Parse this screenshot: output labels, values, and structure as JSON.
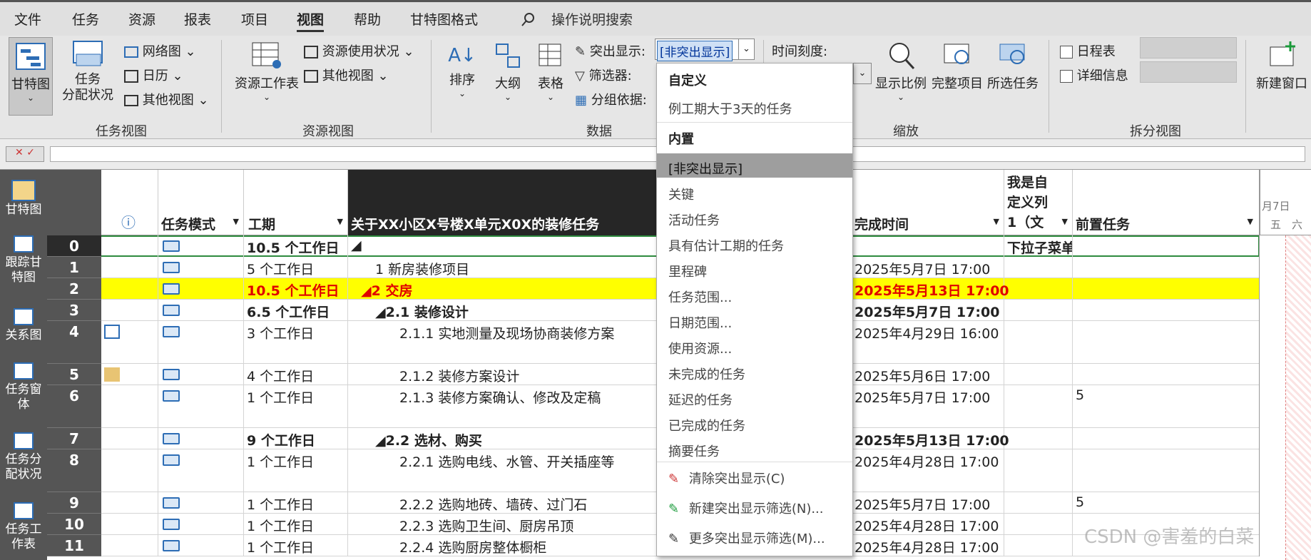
{
  "menubar": {
    "items": [
      "文件",
      "任务",
      "资源",
      "报表",
      "项目",
      "视图",
      "帮助",
      "甘特图格式"
    ],
    "active": "视图",
    "search": "操作说明搜索"
  },
  "ribbon": {
    "task_view": {
      "gantt": "甘特图",
      "assign": "任务\n分配状况",
      "network": "网络图",
      "calendar": "日历",
      "other": "其他视图",
      "label": "任务视图"
    },
    "resource_view": {
      "sheet": "资源工作表",
      "usage": "资源使用状况",
      "other": "其他视图",
      "label": "资源视图"
    },
    "data": {
      "sort": "排序",
      "outline": "大纲",
      "table": "表格",
      "highlight_label": "突出显示:",
      "highlight_value": "[非突出显示]",
      "filter_label": "筛选器:",
      "group_label": "分组依据:",
      "label": "数据"
    },
    "zoom": {
      "timescale": "时间刻度:",
      "zoom": "显示比例",
      "entire": "完整项目",
      "selected": "所选任务",
      "label": "缩放"
    },
    "split": {
      "timeline": "日程表",
      "details": "详细信息",
      "label": "拆分视图"
    },
    "window": {
      "new": "新建窗口"
    }
  },
  "sidebar": [
    "甘特图",
    "跟踪甘\n特图",
    "关系图",
    "任务窗\n体",
    "任务分\n配状况",
    "任务工\n作表"
  ],
  "headers": {
    "info": "ⓘ",
    "mode": "任务模式",
    "duration": "工期",
    "name": "关于XX小区X号楼X单元X0X的装修任务",
    "finish": "完成时间",
    "custom": "我是自\n定义列\n1（文",
    "pred": "前置任务",
    "gantt_week": "月7日",
    "gantt_days": [
      "五",
      "六"
    ]
  },
  "rows": [
    {
      "id": "0",
      "duration": "10.5 个工作日",
      "name": "◢",
      "finish": "",
      "custom": "下拉子菜单",
      "pred": ""
    },
    {
      "id": "1",
      "duration": "5 个工作日",
      "name": "1 新房装修项目",
      "finish": "2025年5月7日 17:00",
      "custom": "",
      "pred": ""
    },
    {
      "id": "2",
      "duration": "10.5 个工作日",
      "name": "◢2 交房",
      "finish": "2025年5月13日 17:00",
      "custom": "",
      "pred": ""
    },
    {
      "id": "3",
      "duration": "6.5 个工作日",
      "name": "◢2.1 装修设计",
      "finish": "2025年5月7日 17:00",
      "custom": "",
      "pred": ""
    },
    {
      "id": "4",
      "duration": "3 个工作日",
      "name": "2.1.1 实地测量及现场协商装修方案",
      "finish": "2025年4月29日 16:00",
      "custom": "",
      "pred": ""
    },
    {
      "id": "5",
      "duration": "4 个工作日",
      "name": "2.1.2 装修方案设计",
      "finish": "2025年5月6日 17:00",
      "custom": "",
      "pred": ""
    },
    {
      "id": "6",
      "duration": "1 个工作日",
      "name": "2.1.3 装修方案确认、修改及定稿",
      "finish": "2025年5月7日 17:00",
      "custom": "",
      "pred": "5"
    },
    {
      "id": "7",
      "duration": "9 个工作日",
      "name": "◢2.2 选材、购买",
      "finish": "2025年5月13日 17:00",
      "custom": "",
      "pred": ""
    },
    {
      "id": "8",
      "duration": "1 个工作日",
      "name": "2.2.1 选购电线、水管、开关插座等",
      "finish": "2025年4月28日 17:00",
      "custom": "",
      "pred": ""
    },
    {
      "id": "9",
      "duration": "1 个工作日",
      "name": "2.2.2 选购地砖、墙砖、过门石",
      "finish": "2025年5月7日 17:00",
      "custom": "",
      "pred": "5"
    },
    {
      "id": "10",
      "duration": "1 个工作日",
      "name": "2.2.3 选购卫生间、厨房吊顶",
      "finish": "2025年4月28日 17:00",
      "custom": "",
      "pred": ""
    },
    {
      "id": "11",
      "duration": "1 个工作日",
      "name": "2.2.4 选购厨房整体橱柜",
      "finish": "2025年4月28日 17:00",
      "custom": "",
      "pred": ""
    }
  ],
  "dropdown": {
    "custom_header": "自定义",
    "custom_items": [
      "例工期大于3天的任务"
    ],
    "builtin_header": "内置",
    "builtin_items": [
      "[非突出显示]",
      "关键",
      "活动任务",
      "具有估计工期的任务",
      "里程碑",
      "任务范围...",
      "日期范围...",
      "使用资源...",
      "未完成的任务",
      "延迟的任务",
      "已完成的任务",
      "摘要任务"
    ],
    "actions": [
      "清除突出显示(C)",
      "新建突出显示筛选(N)...",
      "更多突出显示筛选(M)..."
    ]
  },
  "watermark": "CSDN @害羞的白菜",
  "colors": {
    "highlight_row": "#ffff00",
    "accent": "#2d6db5"
  }
}
